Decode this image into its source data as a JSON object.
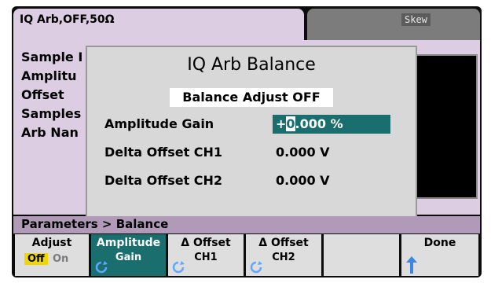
{
  "header": {
    "title": "IQ Arb,OFF,50Ω",
    "skew_tab": "Skew"
  },
  "background_params": {
    "items": [
      "Sample I",
      "Amplitu",
      "Offset",
      "Samples",
      "Arb Nan"
    ]
  },
  "dialog": {
    "title": "IQ Arb Balance",
    "status": "Balance Adjust OFF",
    "rows": [
      {
        "label": "Amplitude Gain",
        "value_sign": "+",
        "value_cursor": "0",
        "value_rest": ".000 %"
      },
      {
        "label": "Delta Offset CH1",
        "value": "0.000 V"
      },
      {
        "label": "Delta Offset CH2",
        "value": "0.000 V"
      }
    ]
  },
  "breadcrumb": "Parameters > Balance",
  "softkeys": {
    "adjust": {
      "label": "Adjust",
      "off": "Off",
      "on": "On"
    },
    "amplitude_gain": {
      "line1": "Amplitude",
      "line2": "Gain"
    },
    "offset_ch1": {
      "line1": "Δ Offset",
      "line2": "CH1"
    },
    "offset_ch2": {
      "line1": "Δ Offset",
      "line2": "CH2"
    },
    "done": {
      "label": "Done"
    }
  },
  "colors": {
    "tab_bg": "#dccde3",
    "accent_teal": "#1a6e6e",
    "toggle_yellow": "#f1d600",
    "breadcrumb_bg": "#b09ab8"
  }
}
